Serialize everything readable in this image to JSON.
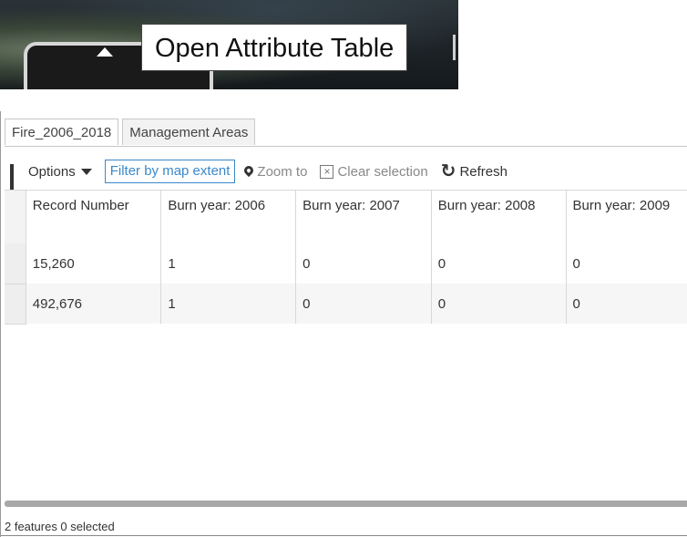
{
  "map": {
    "tooltip": "Open Attribute Table",
    "icons": [
      "caret-up-icon"
    ]
  },
  "tabs": [
    {
      "label": "Fire_2006_2018",
      "active": true
    },
    {
      "label": "Management Areas",
      "active": false
    }
  ],
  "toolbar": {
    "options_label": "Options",
    "filter_label": "Filter by map extent",
    "zoom_label": "Zoom to",
    "clear_label": "Clear selection",
    "refresh_label": "Refresh"
  },
  "table": {
    "columns": [
      "Record Number",
      "Burn year: 2006",
      "Burn year: 2007",
      "Burn year: 2008",
      "Burn year: 2009"
    ],
    "rows": [
      [
        "15,260",
        "1",
        "0",
        "0",
        "0"
      ],
      [
        "492,676",
        "1",
        "0",
        "0",
        "0"
      ]
    ]
  },
  "status": "2 features 0 selected",
  "colors": {
    "accent": "#3b88c9",
    "text": "#333333",
    "muted": "#888888"
  }
}
